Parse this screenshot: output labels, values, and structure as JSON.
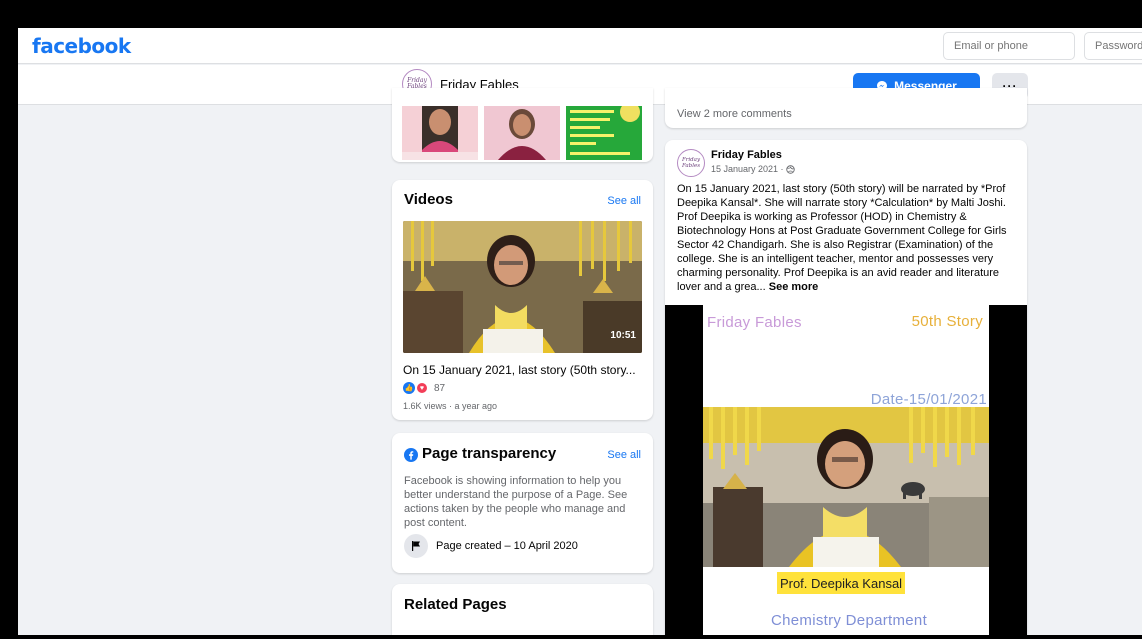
{
  "header": {
    "logo": "facebook",
    "email_placeholder": "Email or phone",
    "password_placeholder": "Password"
  },
  "page_bar": {
    "avatar_text": "Friday Fables",
    "page_name": "Friday Fables",
    "messenger_label": "Messenger",
    "more_label": "···"
  },
  "videos": {
    "title": "Videos",
    "see_all": "See all",
    "duration": "10:51",
    "video_title": "On 15 January 2021, last story (50th story...",
    "reaction_count": "87",
    "meta": "1.6K views · a year ago"
  },
  "transparency": {
    "title": "Page transparency",
    "see_all": "See all",
    "description": "Facebook is showing information to help you better understand the purpose of a Page. See actions taken by the people who manage and post content.",
    "created": "Page created – 10 April 2020"
  },
  "related": {
    "title": "Related Pages"
  },
  "comments": {
    "more": "View 2 more comments"
  },
  "post": {
    "author": "Friday Fables",
    "date": "15 January 2021 ·",
    "text": "On 15 January 2021, last story (50th story) will be narrated by *Prof Deepika Kansal*. She will narrate story *Calculation* by Malti Joshi. Prof Deepika is working as Professor (HOD) in Chemistry & Biotechnology Hons at Post Graduate Government College for Girls Sector 42 Chandigarh. She is also Registrar (Examination) of the college. She is an intelligent teacher,  mentor and possesses very charming personality. Prof Deepika is an avid reader and literature lover and a grea...",
    "see_more": "See more",
    "poster": {
      "title": "Friday Fables",
      "story": "50th Story",
      "date": "Date-15/01/2021",
      "name": "Prof. Deepika Kansal",
      "department": "Chemistry Department"
    }
  },
  "colors": {
    "brand": "#1877f2",
    "background": "#f0f2f5"
  }
}
